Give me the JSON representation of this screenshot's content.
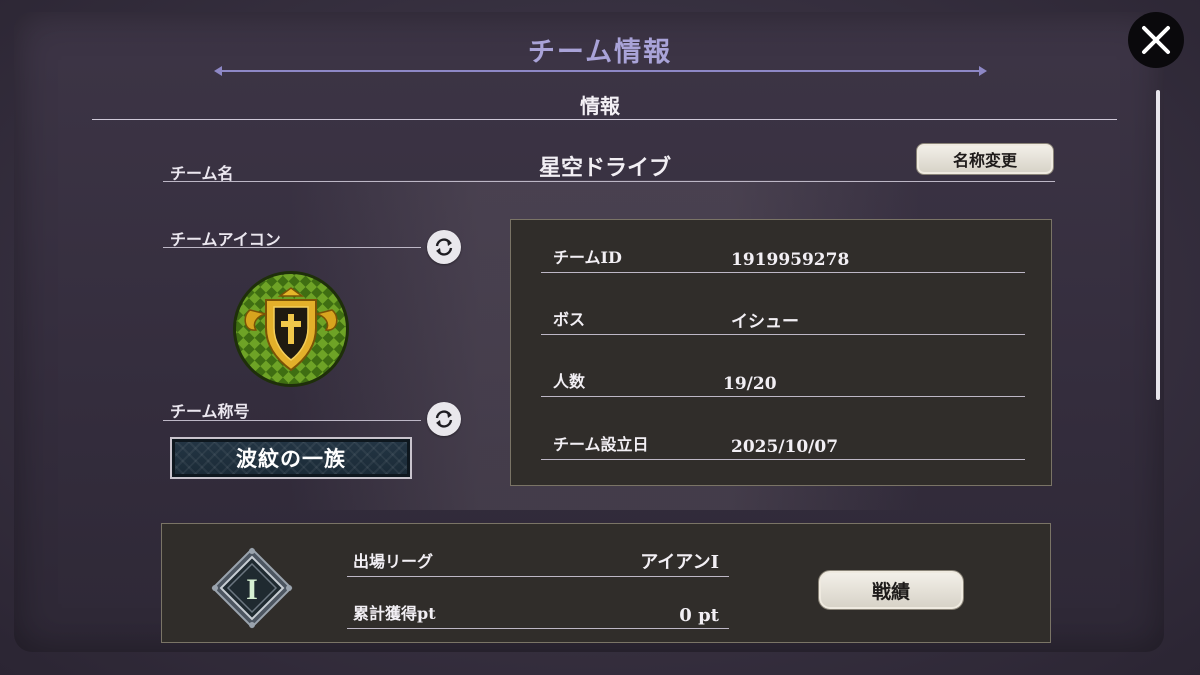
{
  "header": {
    "title": "チーム情報",
    "close_icon": "close-icon"
  },
  "section": {
    "title": "情報"
  },
  "team": {
    "name_label": "チーム名",
    "name": "星空ドライブ",
    "rename_button": "名称変更",
    "icon_label": "チームアイコン",
    "emblem_icon": "shield-cross-emblem-icon",
    "title_label": "チーム称号",
    "title_value": "波紋の一族"
  },
  "info": [
    {
      "label": "チームID",
      "value": "1919959278"
    },
    {
      "label": "ボス",
      "value": "イシュー"
    },
    {
      "label": "人数",
      "value": "19/20"
    },
    {
      "label": "チーム設立日",
      "value": "2025/10/07"
    }
  ],
  "league": {
    "badge_icon": "league-rank-badge-icon",
    "badge_text": "I",
    "entry_label": "出場リーグ",
    "entry_value": "アイアンⅠ",
    "points_label": "累計獲得pt",
    "points_value": "0 pt",
    "record_button": "戦績"
  },
  "colors": {
    "title": "#a9a3d8",
    "panel": "#302d2a",
    "emblem_green": "#5a8a1c",
    "gold": "#d8a41e"
  }
}
